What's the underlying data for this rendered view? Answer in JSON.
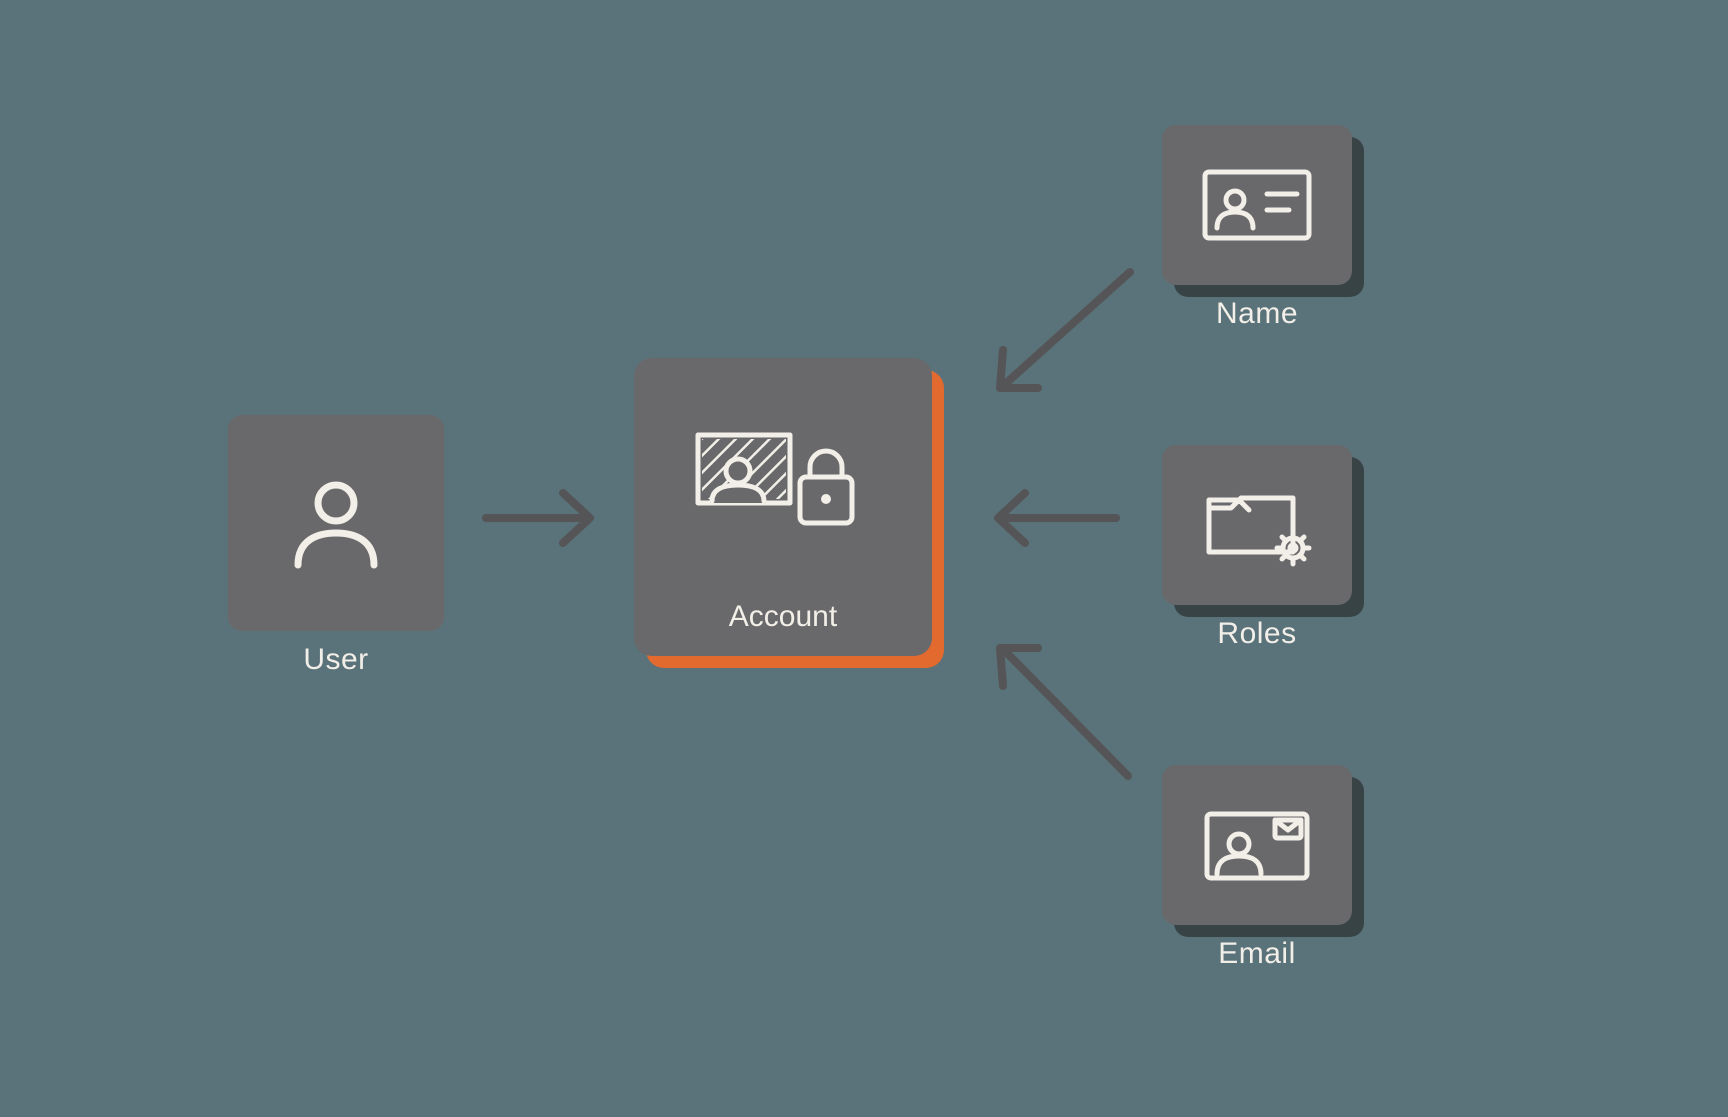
{
  "diagram": {
    "nodes": {
      "user": {
        "label": "User",
        "icon": "user-icon"
      },
      "account": {
        "label": "Account",
        "icon": "account-lock-icon",
        "highlight": "orange"
      },
      "name": {
        "label": "Name",
        "icon": "id-card-icon"
      },
      "roles": {
        "label": "Roles",
        "icon": "folder-gear-icon"
      },
      "email": {
        "label": "Email",
        "icon": "email-card-icon"
      }
    },
    "edges": [
      {
        "from": "user",
        "to": "account"
      },
      {
        "from": "name",
        "to": "account"
      },
      {
        "from": "roles",
        "to": "account"
      },
      {
        "from": "email",
        "to": "account"
      }
    ],
    "colors": {
      "background": "#5a7279",
      "tile": "#69696b",
      "shadow": "#2b2b2d",
      "accent": "#e36a2f",
      "foreground": "#f2eee8",
      "arrow": "#555456"
    }
  }
}
